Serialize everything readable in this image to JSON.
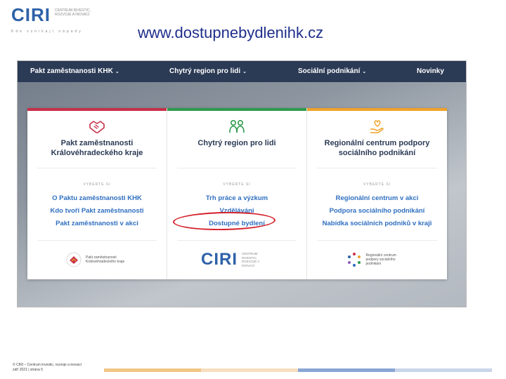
{
  "slide": {
    "logo_text": "CIRI",
    "logo_tagline": "Centrum investic, rozvoje a inovací",
    "logo_subline": "Kde vznikají nápady",
    "url": "www.dostupnebydlenihk.cz",
    "footer_line1": "© CIRI – Centrum investic, rozvoje a inovací",
    "footer_line2": "září 2021 | strana 5"
  },
  "nav": {
    "items": [
      {
        "label": "Pakt zaměstnanosti KHK",
        "has_dropdown": true
      },
      {
        "label": "Chytrý region pro lidi",
        "has_dropdown": true
      },
      {
        "label": "Sociální podnikání",
        "has_dropdown": true
      },
      {
        "label": "Novinky",
        "has_dropdown": false
      }
    ],
    "chevron": "⌄"
  },
  "cards": [
    {
      "accent": "#c7304a",
      "icon": "handshake-icon",
      "title": "Pakt zaměstnanosti Královéhradeckého kraje",
      "kicker": "VYBERTE SI",
      "links": [
        "O Paktu zaměstnanosti KHK",
        "Kdo tvoří Pakt zaměstnanosti",
        "Pakt zaměstnanosti v akci"
      ],
      "partner_text": "Pakt zaměstnanosti Královéhradeckého kraje"
    },
    {
      "accent": "#2e9a4e",
      "icon": "people-icon",
      "title": "Chytrý region pro lidi",
      "kicker": "VYBERTE SI",
      "links": [
        "Trh práce a výzkum",
        "Vzdělávání",
        "Dostupné bydlení"
      ],
      "partner_logo": "CIRI",
      "partner_text": "Centrum investic, rozvoje a inovací"
    },
    {
      "accent": "#f0a22a",
      "icon": "heart-hand-icon",
      "title": "Regionální centrum podpory sociálního podnikání",
      "kicker": "VYBERTE SI",
      "links": [
        "Regionální centrum v akci",
        "Podpora sociálního podnikání",
        "Nabídka sociálních podniků v kraji"
      ],
      "partner_text": "Regionální centrum podpory sociálního podnikání"
    }
  ],
  "highlighted_link": "Dostupné bydlení"
}
